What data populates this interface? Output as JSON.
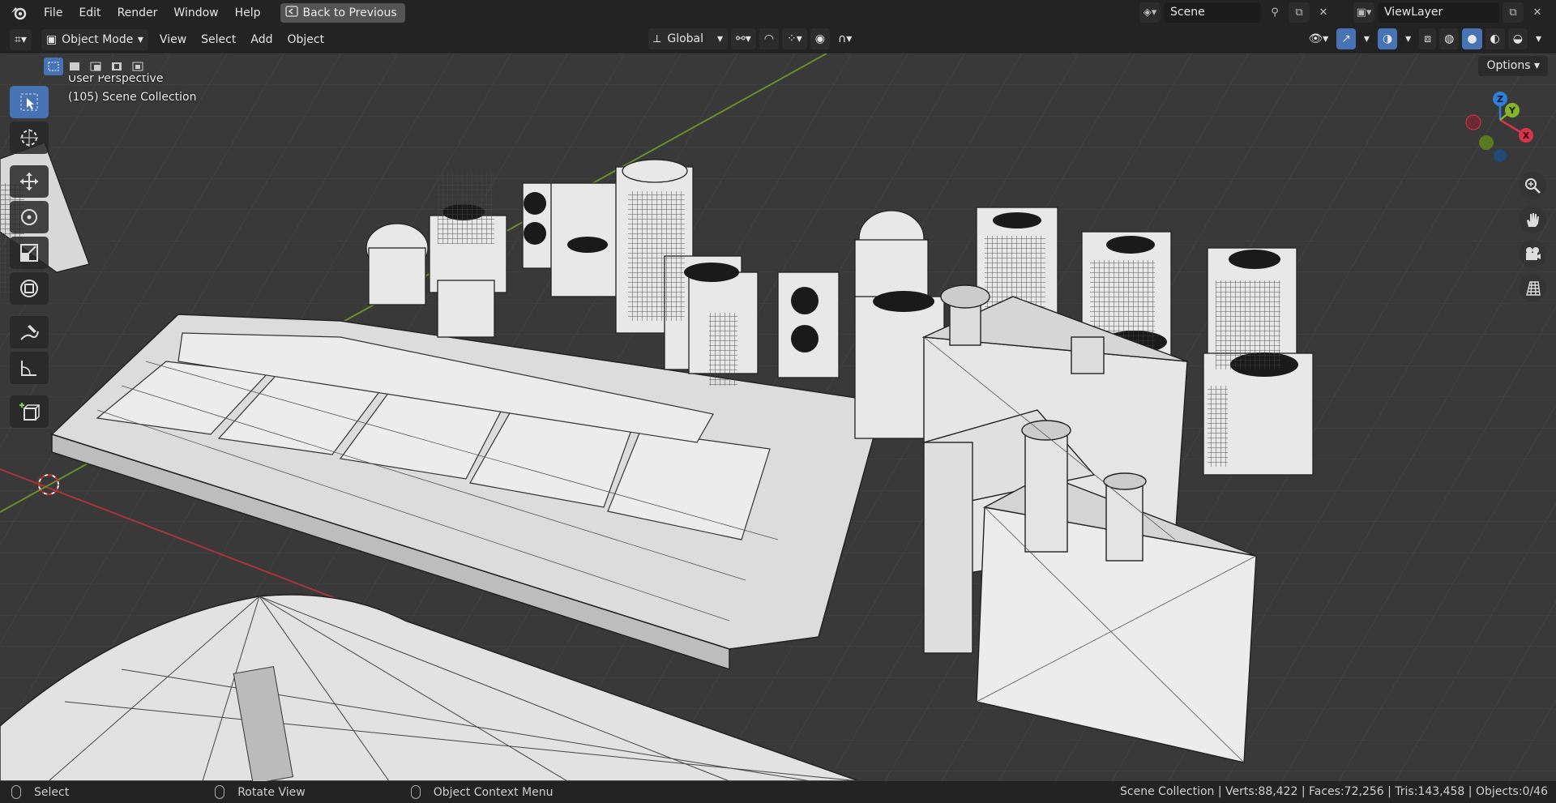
{
  "topbar": {
    "menus": [
      "File",
      "Edit",
      "Render",
      "Window",
      "Help"
    ],
    "back_button": "Back to Previous",
    "scene_name": "Scene",
    "view_layer": "ViewLayer"
  },
  "header": {
    "mode": "Object Mode",
    "menus": [
      "View",
      "Select",
      "Add",
      "Object"
    ],
    "transform_orientation": "Global"
  },
  "viewport": {
    "perspective": "User Perspective",
    "collection": "(105) Scene Collection",
    "options": "Options",
    "axes": {
      "x": "X",
      "y": "Y",
      "z": "Z"
    }
  },
  "statusbar": {
    "select": "Select",
    "rotate": "Rotate View",
    "context": "Object Context Menu",
    "stats": "Scene Collection | Verts:88,422 | Faces:72,256 | Tris:143,458 | Objects:0/46"
  },
  "colors": {
    "accent": "#4772b3",
    "x_axis": "#d8344a",
    "y_axis": "#87b32b",
    "z_axis": "#2f7fd6",
    "viewport_bg": "#393939"
  },
  "icons": [
    "blender-logo-icon",
    "select-box-icon",
    "cursor-icon",
    "move-icon",
    "rotate-icon",
    "scale-icon",
    "transform-icon",
    "annotate-icon",
    "measure-icon",
    "add-cube-icon",
    "zoom-icon",
    "hand-icon",
    "camera-icon",
    "grid-icon"
  ]
}
